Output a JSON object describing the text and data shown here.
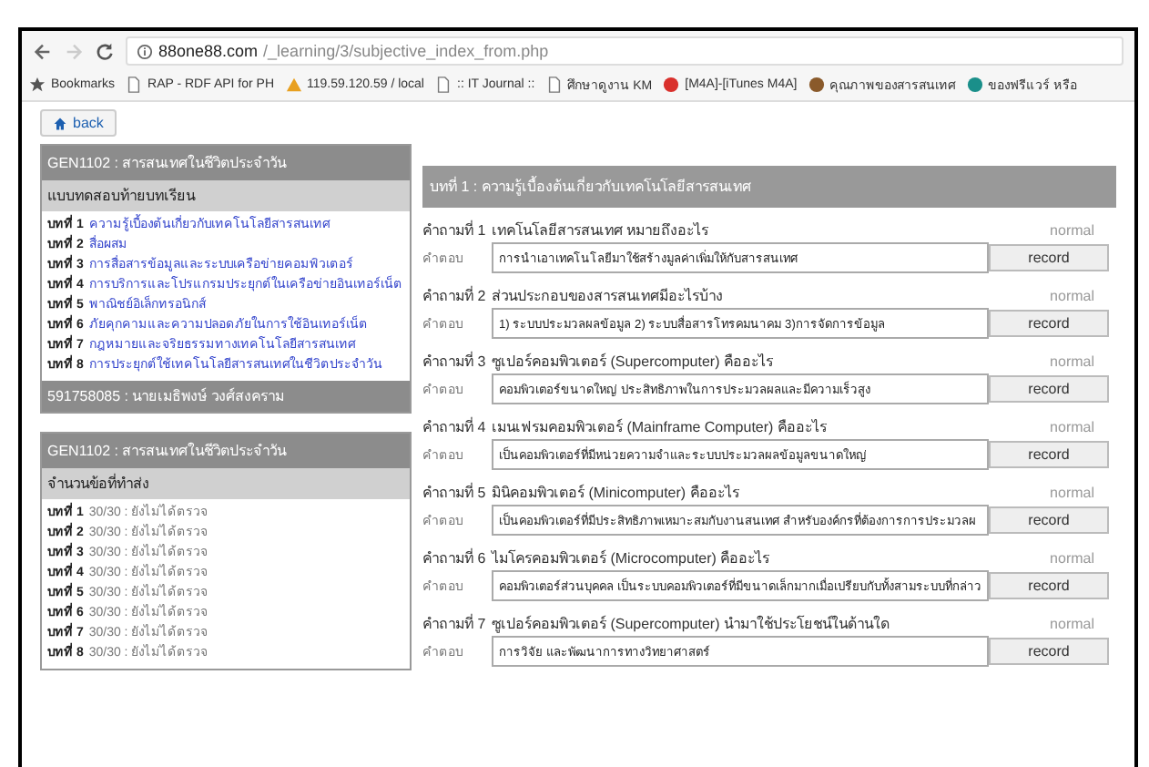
{
  "browser": {
    "url_host": "88one88.com",
    "url_path": "/_learning/3/subjective_index_from.php",
    "bookmarks": [
      {
        "kind": "star",
        "label": "Bookmarks"
      },
      {
        "kind": "page",
        "label": "RAP - RDF API for PH"
      },
      {
        "kind": "warn",
        "label": "119.59.120.59 / local"
      },
      {
        "kind": "page",
        "label": ":: IT Journal ::"
      },
      {
        "kind": "page",
        "label": "ศึกษาดูงาน KM"
      },
      {
        "kind": "red",
        "label": "[M4A]-[iTunes M4A]"
      },
      {
        "kind": "brown",
        "label": "คุณภาพของสารสนเทศ"
      },
      {
        "kind": "teal",
        "label": "ของฟรีแวร์ หรือ"
      }
    ]
  },
  "back_button": "back",
  "lessons_panel": {
    "title": "GEN1102 : สารสนเทศในชีวิตประจำวัน",
    "subtitle": "แบบทดสอบท้ายบทเรียน",
    "items": [
      {
        "label": "บทที่ 1",
        "text": "ความรู้เบื้องต้นเกี่ยวกับเทคโนโลยีสารสนเทศ"
      },
      {
        "label": "บทที่ 2",
        "text": "สื่อผสม"
      },
      {
        "label": "บทที่ 3",
        "text": "การสื่อสารข้อมูลและระบบเครือข่ายคอมพิวเตอร์"
      },
      {
        "label": "บทที่ 4",
        "text": "การบริการและโปรแกรมประยุกต์ในเครือข่ายอินเทอร์เน็ต"
      },
      {
        "label": "บทที่ 5",
        "text": "พาณิชย์อิเล็กทรอนิกส์"
      },
      {
        "label": "บทที่ 6",
        "text": "ภัยคุกคามและความปลอดภัยในการใช้อินเทอร์เน็ต"
      },
      {
        "label": "บทที่ 7",
        "text": "กฎหมายและจริยธรรมทางเทคโนโลยีสารสนเทศ"
      },
      {
        "label": "บทที่ 8",
        "text": "การประยุกต์ใช้เทคโนโลยีสารสนเทศในชีวิตประจำวัน"
      }
    ],
    "footer": "591758085 : นายเมธิพงษ์ วงศ์สงคราม"
  },
  "status_panel": {
    "title": "GEN1102 : สารสนเทศในชีวิตประจำวัน",
    "subtitle": "จำนวนข้อที่ทำส่ง",
    "items": [
      {
        "label": "บทที่ 1",
        "text": "30/30 : ยังไม่ได้ตรวจ"
      },
      {
        "label": "บทที่ 2",
        "text": "30/30 : ยังไม่ได้ตรวจ"
      },
      {
        "label": "บทที่ 3",
        "text": "30/30 : ยังไม่ได้ตรวจ"
      },
      {
        "label": "บทที่ 4",
        "text": "30/30 : ยังไม่ได้ตรวจ"
      },
      {
        "label": "บทที่ 5",
        "text": "30/30 : ยังไม่ได้ตรวจ"
      },
      {
        "label": "บทที่ 6",
        "text": "30/30 : ยังไม่ได้ตรวจ"
      },
      {
        "label": "บทที่ 7",
        "text": "30/30 : ยังไม่ได้ตรวจ"
      },
      {
        "label": "บทที่ 8",
        "text": "30/30 : ยังไม่ได้ตรวจ"
      }
    ]
  },
  "questions_panel": {
    "title": "บทที่ 1 : ความรู้เบื้องต้นเกี่ยวกับเทคโนโลยีสารสนเทศ",
    "questions": [
      {
        "label": "คำถามที่ 1",
        "question": "เทคโนโลยีสารสนเทศ หมายถึงอะไร",
        "status": "normal",
        "answer_label": "คำตอบ",
        "answer": "การนำเอาเทคโนโลยีมาใช้สร้างมูลค่าเพิ่มให้กับสารสนเทศ",
        "button": "record"
      },
      {
        "label": "คำถามที่ 2",
        "question": "ส่วนประกอบของสารสนเทศมีอะไรบ้าง",
        "status": "normal",
        "answer_label": "คำตอบ",
        "answer": "1) ระบบประมวลผลข้อมูล  2) ระบบสื่อสารโทรคมนาคม  3)การจัดการข้อมูล",
        "button": "record"
      },
      {
        "label": "คำถามที่ 3",
        "question": "ซูเปอร์คอมพิวเตอร์ (Supercomputer) คืออะไร",
        "status": "normal",
        "answer_label": "คำตอบ",
        "answer": "คอมพิวเตอร์ขนาดใหญ่ ประสิทธิภาพในการประมวลผลและมีความเร็วสูง",
        "button": "record"
      },
      {
        "label": "คำถามที่ 4",
        "question": "เมนเฟรมคอมพิวเตอร์ (Mainframe Computer) คืออะไร",
        "status": "normal",
        "answer_label": "คำตอบ",
        "answer": "เป็นคอมพิวเตอร์ที่มีหน่วยความจำและระบบประมวลผลข้อมูลขนาดใหญ่",
        "button": "record"
      },
      {
        "label": "คำถามที่ 5",
        "question": "มินิคอมพิวเตอร์ (Minicomputer) คืออะไร",
        "status": "normal",
        "answer_label": "คำตอบ",
        "answer": "เป็นคอมพิวเตอร์ที่มีประสิทธิภาพเหมาะสมกับงานสนเทศ  สำหรับองค์กรที่ต้องการการประมวลผ",
        "button": "record"
      },
      {
        "label": "คำถามที่ 6",
        "question": "ไมโครคอมพิวเตอร์ (Microcomputer) คืออะไร",
        "status": "normal",
        "answer_label": "คำตอบ",
        "answer": "คอมพิวเตอร์ส่วนบุคคล  เป็นระบบคอมพิวเตอร์ที่มีขนาดเล็กมากเมื่อเปรียบกับทั้งสามระบบที่กล่าว",
        "button": "record"
      },
      {
        "label": "คำถามที่ 7",
        "question": "ซูเปอร์คอมพิวเตอร์ (Supercomputer) นำมาใช้ประโยชน์ในด้านใด",
        "status": "normal",
        "answer_label": "คำตอบ",
        "answer": "การวิจัย และพัฒนาการทางวิทยาศาสตร์",
        "button": "record"
      }
    ]
  }
}
